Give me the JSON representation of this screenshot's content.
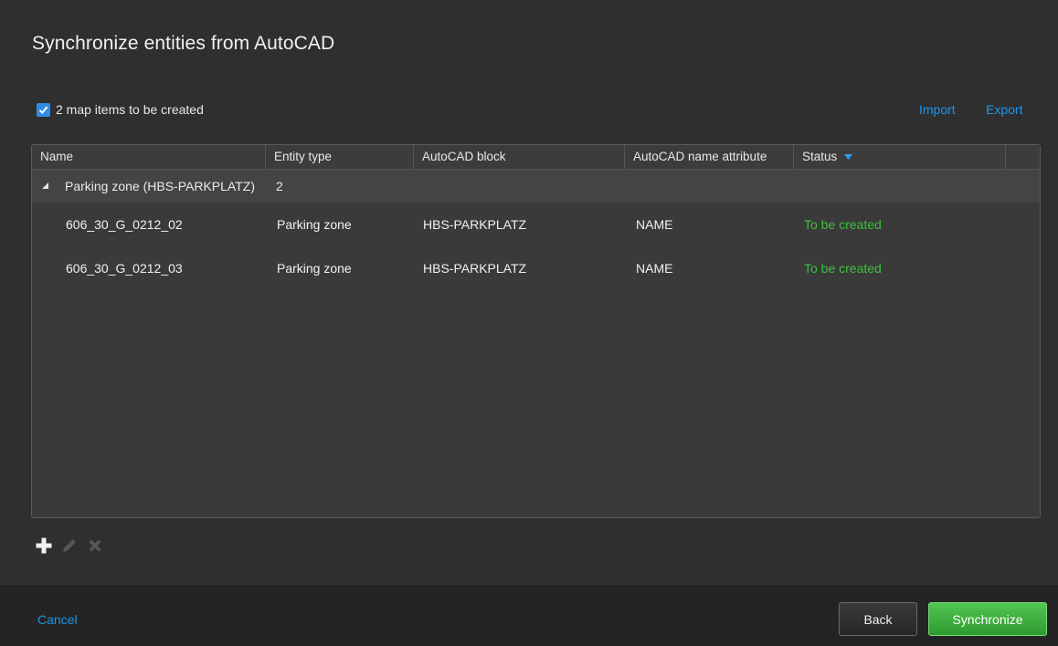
{
  "dialog": {
    "title": "Synchronize entities from AutoCAD",
    "checkbox_label": "2 map items to be created",
    "checkbox_checked": true,
    "import_label": "Import",
    "export_label": "Export"
  },
  "table": {
    "columns": [
      "Name",
      "Entity type",
      "AutoCAD block",
      "AutoCAD name attribute",
      "Status"
    ],
    "group": {
      "label": "Parking zone (HBS-PARKPLATZ)",
      "count": "2"
    },
    "rows": [
      {
        "name": "606_30_G_0212_02",
        "entity_type": "Parking zone",
        "block": "HBS-PARKPLATZ",
        "name_attribute": "NAME",
        "status": "To be created"
      },
      {
        "name": "606_30_G_0212_03",
        "entity_type": "Parking zone",
        "block": "HBS-PARKPLATZ",
        "name_attribute": "NAME",
        "status": "To be created"
      }
    ]
  },
  "toolbar": {
    "icons": [
      "add-icon",
      "edit-icon",
      "delete-icon"
    ]
  },
  "footer": {
    "cancel_label": "Cancel",
    "back_label": "Back",
    "synchronize_label": "Synchronize"
  },
  "colors": {
    "accent": "#1f94ea",
    "status_ok": "#3fbf3f",
    "primary_button": "#3fb53f"
  }
}
